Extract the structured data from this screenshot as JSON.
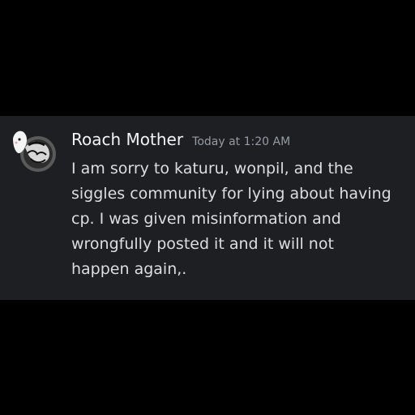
{
  "message": {
    "author": "Roach Mother",
    "timestamp": "Today at 1:20 AM",
    "content": "I am sorry to katuru, wonpil, and the\nsiggles community for lying about having\ncp. I was given misinformation and\nwrongfully posted it and it will not\nhappen again,."
  },
  "colors": {
    "background": "#000000",
    "panel": "#1e1f22",
    "username": "#f2f3f5",
    "timestamp": "#949ba4",
    "message_text": "#dbdee1"
  },
  "icons": {
    "avatar": "avatar-icon"
  }
}
